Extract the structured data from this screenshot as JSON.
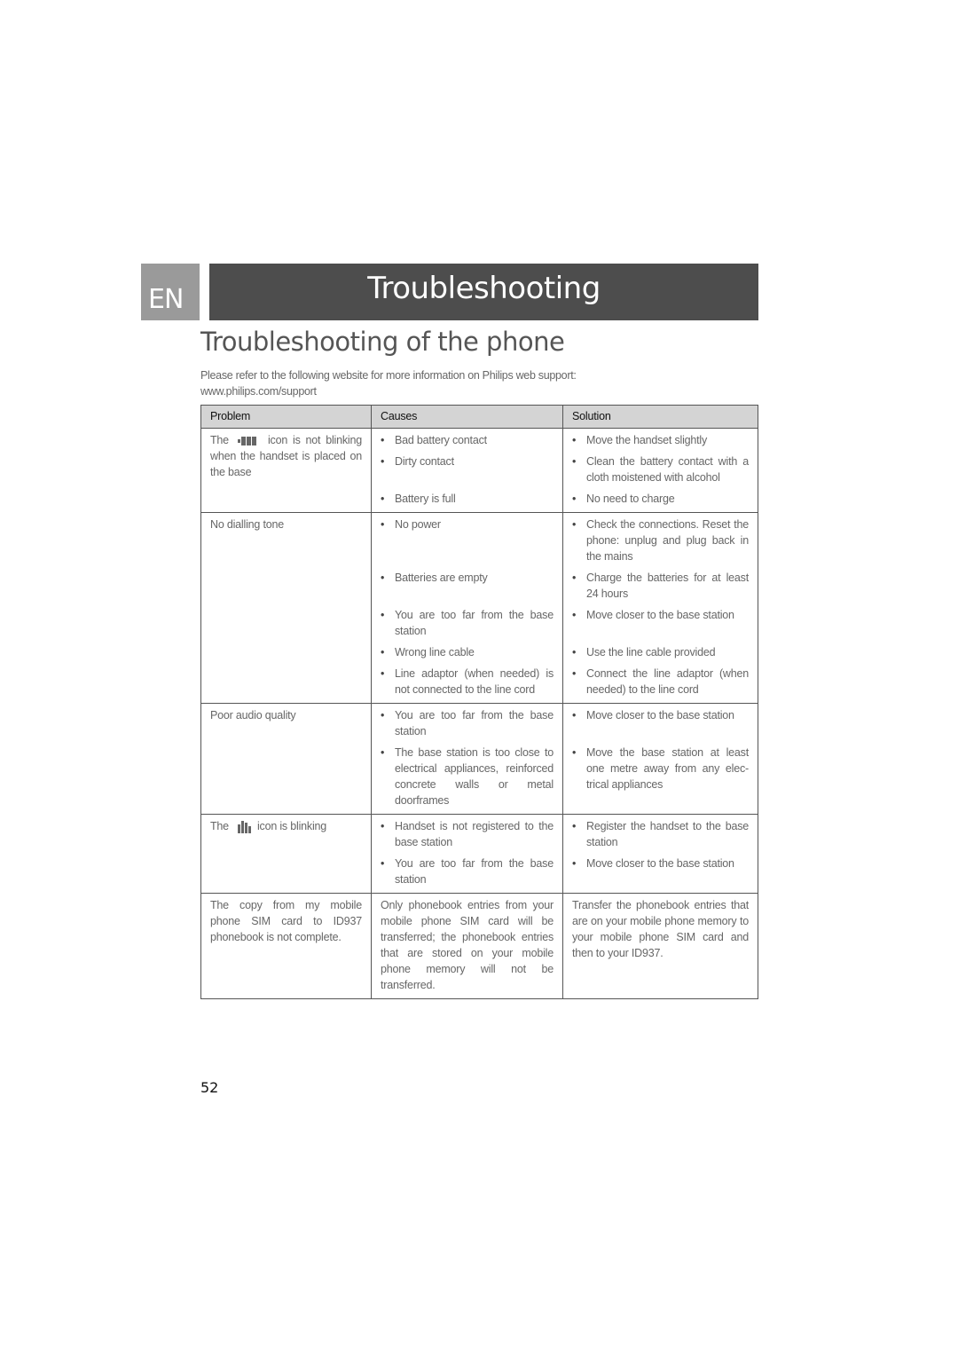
{
  "header": {
    "language_badge": "EN",
    "section_title": "Troubleshooting"
  },
  "page_title": "Troubleshooting of the phone",
  "intro": {
    "line1": "Please refer to the following website for more information on Philips web support:",
    "line2": "www.philips.com/support"
  },
  "table": {
    "columns": [
      "Problem",
      "Causes",
      "Solution"
    ],
    "rows": [
      {
        "problem_prefix": "The",
        "problem_icon": "battery-icon",
        "problem_suffix": "icon is not blinking when the handset is placed on the base",
        "causes": [
          "Bad battery contact",
          "Dirty contact",
          "Battery is full"
        ],
        "solutions": [
          "Move the handset slightly",
          "Clean the battery contact with a cloth moistened with alcohol",
          "No need to charge"
        ]
      },
      {
        "problem": "No dialling tone",
        "causes": [
          "No power",
          "Batteries are empty",
          "You are too far from the base station",
          "Wrong line cable",
          "Line adaptor (when needed) is not connected to the line cord"
        ],
        "solutions": [
          "Check the connections. Reset the phone: unplug and plug back in the mains",
          "Charge the batteries for at least 24 hours",
          "Move closer to the base station",
          "Use the line cable provided",
          "Connect the line adaptor (when needed) to the line cord"
        ]
      },
      {
        "problem": "Poor audio quality",
        "causes": [
          "You are too far from the base station",
          "The base station is too close to electrical appliances, reinforced concrete walls or metal doorframes"
        ],
        "solutions": [
          "Move closer to the base station",
          "Move the base station at least one metre away from any elec-trical appliances"
        ]
      },
      {
        "problem_prefix": "The",
        "problem_icon": "signal-icon",
        "problem_suffix": "icon is blinking",
        "causes": [
          "Handset is not registered to the base station",
          "You are too far from the base station"
        ],
        "solutions": [
          "Register the handset to the base station",
          "Move closer to the base station"
        ]
      },
      {
        "problem": "The copy from my mobile phone SIM card to ID937 phonebook is not complete.",
        "cause_text": "Only phonebook entries from your mobile phone SIM card will be transferred; the phonebook entries that are stored on your mobile phone memory will not be transferred.",
        "solution_text": "Transfer the phonebook entries that are on your mobile phone memory to your mobile phone SIM card and then to your ID937."
      }
    ]
  },
  "page_number": "52"
}
